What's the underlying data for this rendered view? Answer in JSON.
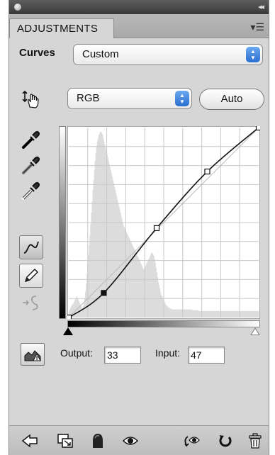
{
  "panel": {
    "tab_label": "ADJUSTMENTS",
    "adjustment_name": "Curves",
    "preset_value": "Custom",
    "channel_value": "RGB",
    "auto_label": "Auto",
    "output_label": "Output:",
    "output_value": "33",
    "input_label": "Input:",
    "input_value": "47"
  },
  "curve": {
    "points": [
      [
        0,
        0
      ],
      [
        47,
        33
      ],
      [
        118,
        120
      ],
      [
        186,
        196
      ],
      [
        255,
        255
      ]
    ],
    "selected_point": [
      47,
      33
    ]
  },
  "histogram": [
    8,
    10,
    12,
    14,
    16,
    16,
    18,
    20,
    22,
    24,
    26,
    24,
    22,
    20,
    18,
    16,
    14,
    12,
    12,
    14,
    18,
    24,
    32,
    42,
    54,
    66,
    78,
    90,
    102,
    116,
    130,
    144,
    158,
    170,
    182,
    194,
    204,
    212,
    218,
    222,
    226,
    228,
    230,
    230,
    228,
    226,
    222,
    218,
    214,
    210,
    206,
    202,
    198,
    194,
    190,
    186,
    182,
    178,
    174,
    170,
    166,
    162,
    158,
    154,
    150,
    146,
    142,
    138,
    134,
    130,
    126,
    122,
    118,
    114,
    112,
    110,
    108,
    106,
    104,
    102,
    100,
    98,
    96,
    94,
    92,
    90,
    88,
    86,
    84,
    82,
    80,
    78,
    76,
    74,
    72,
    70,
    68,
    66,
    64,
    62,
    60,
    60,
    62,
    64,
    66,
    68,
    70,
    72,
    74,
    76,
    78,
    80,
    80,
    78,
    76,
    72,
    68,
    62,
    56,
    50,
    44,
    40,
    36,
    32,
    28,
    26,
    24,
    22,
    20,
    18,
    16,
    15,
    14,
    13,
    12,
    12,
    11,
    11,
    10,
    10,
    10,
    10,
    10,
    10,
    10,
    10,
    10,
    10,
    10,
    10,
    10,
    10,
    10,
    10,
    10,
    10,
    10,
    10,
    10,
    10,
    10,
    10,
    10,
    10,
    10,
    10,
    9,
    9,
    9,
    9,
    9,
    9,
    9,
    9,
    8,
    8,
    8,
    8,
    8,
    8,
    8,
    8,
    8,
    8,
    8,
    8,
    8,
    8,
    8,
    8,
    8,
    8,
    8,
    8,
    8,
    8,
    8,
    8,
    8,
    8,
    8,
    8,
    8,
    8,
    8,
    8,
    8,
    8,
    8,
    8,
    8,
    8,
    8,
    8,
    8,
    8,
    8,
    8,
    8,
    8,
    8,
    8,
    8,
    8,
    8,
    8,
    8,
    8,
    8,
    8,
    8,
    8,
    8,
    8,
    8,
    8,
    8,
    8,
    8,
    8,
    8,
    8,
    8,
    8,
    8,
    8,
    8,
    8,
    8,
    8,
    8,
    8,
    8,
    8,
    8,
    8
  ]
}
